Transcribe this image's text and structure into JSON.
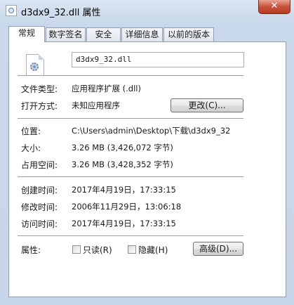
{
  "window": {
    "title": "d3dx9_32.dll 属性",
    "close_glyph": "✕"
  },
  "tabs": [
    "常规",
    "数字签名",
    "安全",
    "详细信息",
    "以前的版本"
  ],
  "general": {
    "file_name": "d3dx9_32.dll",
    "file_type": {
      "label": "文件类型:",
      "value": "应用程序扩展 (.dll)"
    },
    "opens_with": {
      "label": "打开方式:",
      "value": "未知应用程序",
      "button": "更改(C)..."
    },
    "location": {
      "label": "位置:",
      "value": "C:\\Users\\admin\\Desktop\\下载\\d3dx9_32"
    },
    "size": {
      "label": "大小:",
      "value": "3.26 MB (3,426,072 字节)"
    },
    "size_on_disk": {
      "label": "占用空间:",
      "value": "3.26 MB (3,428,352 字节)"
    },
    "created": {
      "label": "创建时间:",
      "value": "2017年4月19日，17:33:15"
    },
    "modified": {
      "label": "修改时间:",
      "value": "2006年11月29日，13:06:18"
    },
    "accessed": {
      "label": "访问时间:",
      "value": "2017年4月19日，17:33:15"
    },
    "attributes": {
      "label": "属性:",
      "readonly": {
        "label": "只读(R)",
        "checked": false
      },
      "hidden": {
        "label": "隐藏(H)",
        "checked": false
      },
      "advanced_button": "高级(D)..."
    }
  },
  "icons": {
    "title": "dll-file-icon",
    "file": "dll-gear-file-icon"
  }
}
